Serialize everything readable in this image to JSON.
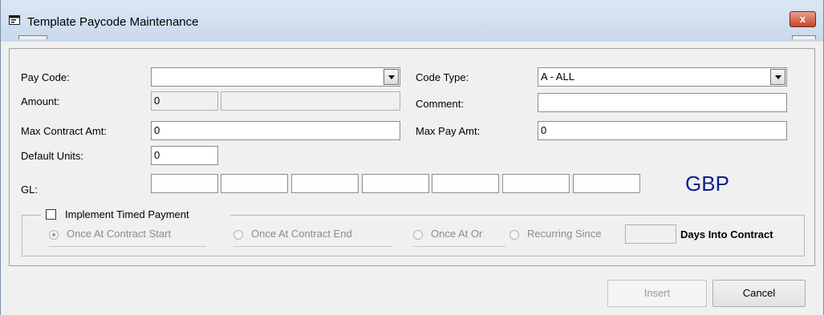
{
  "window": {
    "title": "Template Paycode Maintenance",
    "close_glyph": "x"
  },
  "labels": {
    "pay_code": "Pay Code:",
    "amount": "Amount:",
    "max_contract_amt": "Max Contract Amt:",
    "default_units": "Default Units:",
    "gl": "GL:",
    "code_type": "Code Type:",
    "comment": "Comment:",
    "max_pay_amt": "Max Pay Amt:"
  },
  "fields": {
    "pay_code": "",
    "amount": "0",
    "amount_extra": "",
    "max_contract_amt": "0",
    "default_units": "0",
    "gl_segments": [
      "",
      "",
      "",
      "",
      "",
      "",
      ""
    ],
    "code_type": "A - ALL",
    "comment": "",
    "max_pay_amt": "0"
  },
  "currency": "GBP",
  "timed_payment": {
    "checkbox_label": "Implement Timed Payment",
    "checked": false,
    "options": [
      "Once At Contract Start",
      "Once At Contract End",
      "Once At Or",
      "Recurring Since"
    ],
    "selected": "Once At Contract Start",
    "days_value": "",
    "days_label": "Days Into Contract"
  },
  "buttons": {
    "insert": "Insert",
    "cancel": "Cancel"
  },
  "icons": {
    "window_icon": "form-window-icon",
    "close": "close-icon",
    "dropdown": "chevron-down-icon"
  }
}
